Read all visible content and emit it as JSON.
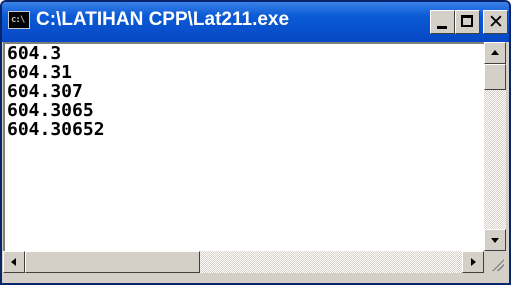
{
  "window": {
    "title": "C:\\LATIHAN CPP\\Lat211.exe",
    "icon": "cmd-console-icon",
    "icon_text": "c:\\"
  },
  "title_buttons": {
    "minimize": "minimize-icon",
    "maximize": "maximize-icon",
    "close_glyph": "✕"
  },
  "console": {
    "lines": [
      "604.3",
      "604.31",
      "604.307",
      "604.3065",
      "604.30652"
    ]
  },
  "colors": {
    "titlebar": "#0a5ad6",
    "window_frame": "#d4d0c8",
    "console_bg": "#ffffff",
    "console_text": "#000000"
  }
}
